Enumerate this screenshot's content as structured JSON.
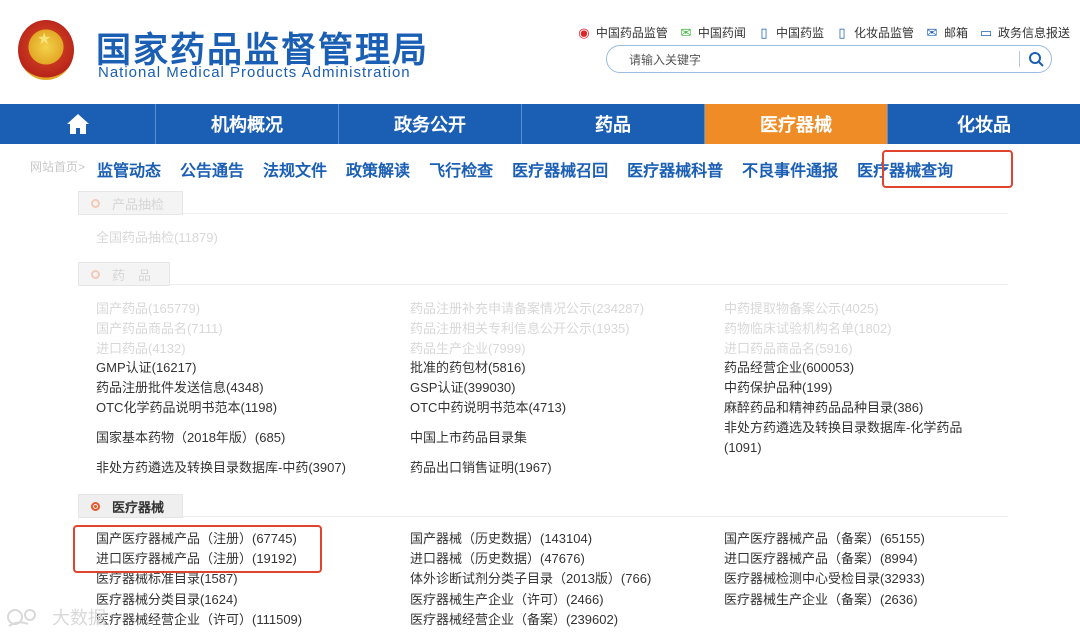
{
  "header": {
    "title_cn": "国家药品监督管理局",
    "title_en": "National Medical Products Administration",
    "links": [
      {
        "icon": "weibo-icon",
        "glyph": "◉",
        "label": "中国药品监管"
      },
      {
        "icon": "wechat-icon",
        "glyph": "✉",
        "label": "中国药闻"
      },
      {
        "icon": "phone-icon",
        "glyph": "▯",
        "label": "中国药监"
      },
      {
        "icon": "phone-icon",
        "glyph": "▯",
        "label": "化妆品监管"
      },
      {
        "icon": "mail-icon",
        "glyph": "✉",
        "label": "邮箱"
      },
      {
        "icon": "monitor-icon",
        "glyph": "▭",
        "label": "政务信息报送"
      }
    ],
    "search_placeholder": "请输入关键字"
  },
  "nav": {
    "home_glyph": "⌂",
    "items": [
      "机构概况",
      "政务公开",
      "药品",
      "医疗器械",
      "化妆品"
    ],
    "active": "医疗器械"
  },
  "subnav": {
    "breadcrumb": "网站首页>",
    "items": [
      "监管动态",
      "公告通告",
      "法规文件",
      "政策解读",
      "飞行检查",
      "医疗器械召回",
      "医疗器械科普",
      "不良事件通报",
      "医疗器械查询"
    ]
  },
  "sections": {
    "sampling": {
      "title": "产品抽检",
      "links": [
        "全国药品抽检(11879)"
      ]
    },
    "drugs": {
      "title": "药　品",
      "faded_links": [
        "国产药品(165779)",
        "药品注册补充申请备案情况公示(234287)",
        "中药提取物备案公示(4025)",
        "国产药品商品名(7111)",
        "药品注册相关专利信息公开公示(1935)",
        "药物临床试验机构名单(1802)",
        "进口药品(4132)",
        "药品生产企业(7999)",
        "进口药品商品名(5916)"
      ],
      "links": [
        "GMP认证(16217)",
        "批准的药包材(5816)",
        "药品经营企业(600053)",
        "药品注册批件发送信息(4348)",
        "GSP认证(399030)",
        "中药保护品种(199)",
        "OTC化学药品说明书范本(1198)",
        "OTC中药说明书范本(4713)",
        "麻醉药品和精神药品品种目录(386)",
        "国家基本药物（2018年版）(685)",
        "中国上市药品目录集",
        "非处方药遴选及转换目录数据库-化学药品",
        "(1091)",
        "非处方药遴选及转换目录数据库-中药(3907)",
        "药品出口销售证明(1967)"
      ]
    },
    "devices": {
      "title": "医疗器械",
      "links": [
        "国产医疗器械产品（注册）(67745)",
        "国产器械（历史数据）(143104)",
        "国产医疗器械产品（备案）(65155)",
        "进口医疗器械产品（注册）(19192)",
        "进口器械（历史数据）(47676)",
        "进口医疗器械产品（备案）(8994)",
        "医疗器械标准目录(1587)",
        "体外诊断试剂分类子目录（2013版）(766)",
        "医疗器械检测中心受检目录(32933)",
        "医疗器械分类目录(1624)",
        "医疗器械生产企业（许可）(2466)",
        "医疗器械生产企业（备案）(2636)",
        "医疗器械经营企业（许可）(111509)",
        "医疗器械经营企业（备案）(239602)"
      ]
    }
  },
  "watermark": "大数据"
}
